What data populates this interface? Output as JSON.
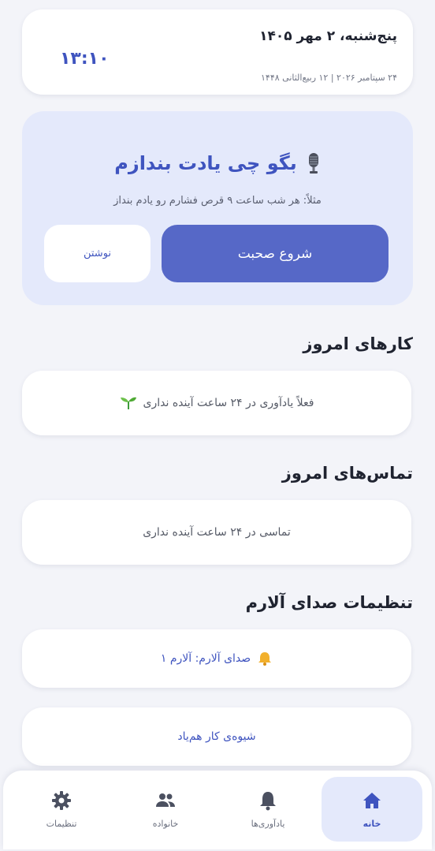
{
  "header": {
    "date_main": "پنج‌شنبه، ۲ مهر ۱۴۰۵",
    "date_sub": "۲۴ سپتامبر ۲۰۲۶  |  ۱۲ ربیع‌الثانی ۱۴۴۸",
    "clock": "۱۳:۱۰"
  },
  "voice": {
    "title": "بگو چی یادت بندازم",
    "example": "مثلاً: هر شب ساعت ۹ قرص فشارم رو یادم بنداز",
    "start_label": "شروع صحبت",
    "write_label": "نوشتن",
    "icon": "microphone-icon"
  },
  "today_tasks": {
    "title": "کارهای امروز",
    "empty_text": "فعلاً یادآوری در ۲۴ ساعت آینده نداری",
    "icon": "sprout-icon"
  },
  "today_calls": {
    "title": "تماس‌های امروز",
    "empty_text": "تماسی در ۲۴ ساعت آینده نداری"
  },
  "alarm_settings": {
    "title": "تنظیمات صدای آلارم",
    "alarm_sound": "صدای آلارم: آلارم ۱",
    "icon": "bell-icon",
    "companion_mode": "شیوه‌ی کار هم‌یاد"
  },
  "nav": {
    "home": "خانه",
    "reminders": "یادآوری‌ها",
    "family": "خانواده",
    "settings": "تنظیمات"
  },
  "colors": {
    "accent": "#3f54bf",
    "button": "#5668c7",
    "panel": "#e4e9fb",
    "background": "#f3f4f9"
  }
}
